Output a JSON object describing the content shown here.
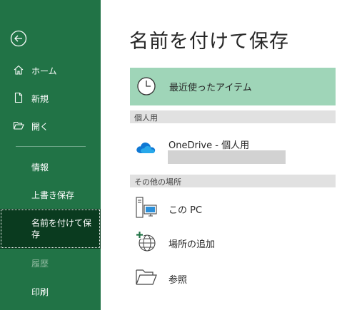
{
  "sidebar": {
    "back_icon": "back-arrow-icon",
    "items": [
      {
        "label": "ホーム",
        "icon": "home-icon"
      },
      {
        "label": "新規",
        "icon": "new-document-icon"
      },
      {
        "label": "開く",
        "icon": "open-folder-icon"
      },
      {
        "label": "情報"
      },
      {
        "label": "上書き保存"
      },
      {
        "label": "名前を付けて保存",
        "selected": true
      },
      {
        "label": "履歴",
        "disabled": true
      },
      {
        "label": "印刷"
      }
    ]
  },
  "main": {
    "title": "名前を付けて保存",
    "recent": {
      "label": "最近使ったアイテム",
      "icon": "clock-icon"
    },
    "sections": [
      {
        "header": "個人用",
        "items": [
          {
            "label": "OneDrive - 個人用",
            "icon": "onedrive-cloud-icon"
          }
        ]
      },
      {
        "header": "その他の場所",
        "items": [
          {
            "label": "この PC",
            "icon": "this-pc-icon"
          },
          {
            "label": "場所の追加",
            "icon": "add-location-globe-icon"
          },
          {
            "label": "参照",
            "icon": "browse-folder-icon"
          }
        ]
      }
    ]
  },
  "colors": {
    "sidebar_bg": "#217346",
    "sidebar_selected_bg": "#0a3b1f",
    "recent_highlight": "#9fd5b8",
    "section_header_bg": "#e1e1e1"
  }
}
